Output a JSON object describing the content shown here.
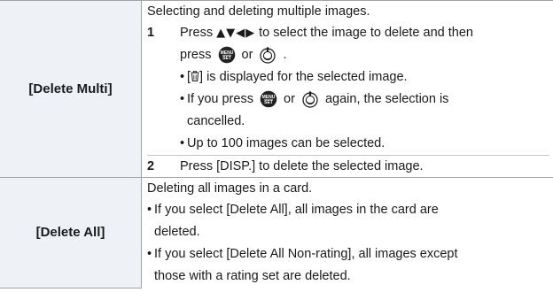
{
  "rows": [
    {
      "label": "[Delete Multi]",
      "intro": "Selecting and deleting multiple images.",
      "step1": {
        "num": "1",
        "line1_pre": "Press ",
        "arrows": "▲▼◀▶",
        "line1_post": " to select the image to delete and then",
        "line2_pre": "press ",
        "or_word": " or ",
        "line2_post": " ."
      },
      "bullet1": {
        "pre": "[",
        "post": "] is displayed for the selected image."
      },
      "bullet2": {
        "pre": "If you press ",
        "or_word": " or ",
        "post": " again, the selection is",
        "cont": "cancelled."
      },
      "bullet3": "Up to 100 images can be selected.",
      "step2": {
        "num": "2",
        "text": "Press [DISP.] to delete the selected image."
      }
    },
    {
      "label": "[Delete All]",
      "intro": "Deleting all images in a card.",
      "bullet1": {
        "line1": "If you select [Delete All], all images in the card are",
        "line2": "deleted."
      },
      "bullet2": {
        "line1": "If you select [Delete All Non-rating], all images except",
        "line2": "those with a rating set are deleted."
      }
    }
  ],
  "icons": {
    "bullet": "•",
    "menu_set_button": "MENU/SET",
    "menu_set_icon": "menu-set-button-icon",
    "joystick_icon": "joystick-press-icon",
    "trash_icon": "trash-can-icon"
  },
  "colors": {
    "label_background": "#eef2f6",
    "border": "#a3a3a3",
    "button_dark": "#222222"
  }
}
